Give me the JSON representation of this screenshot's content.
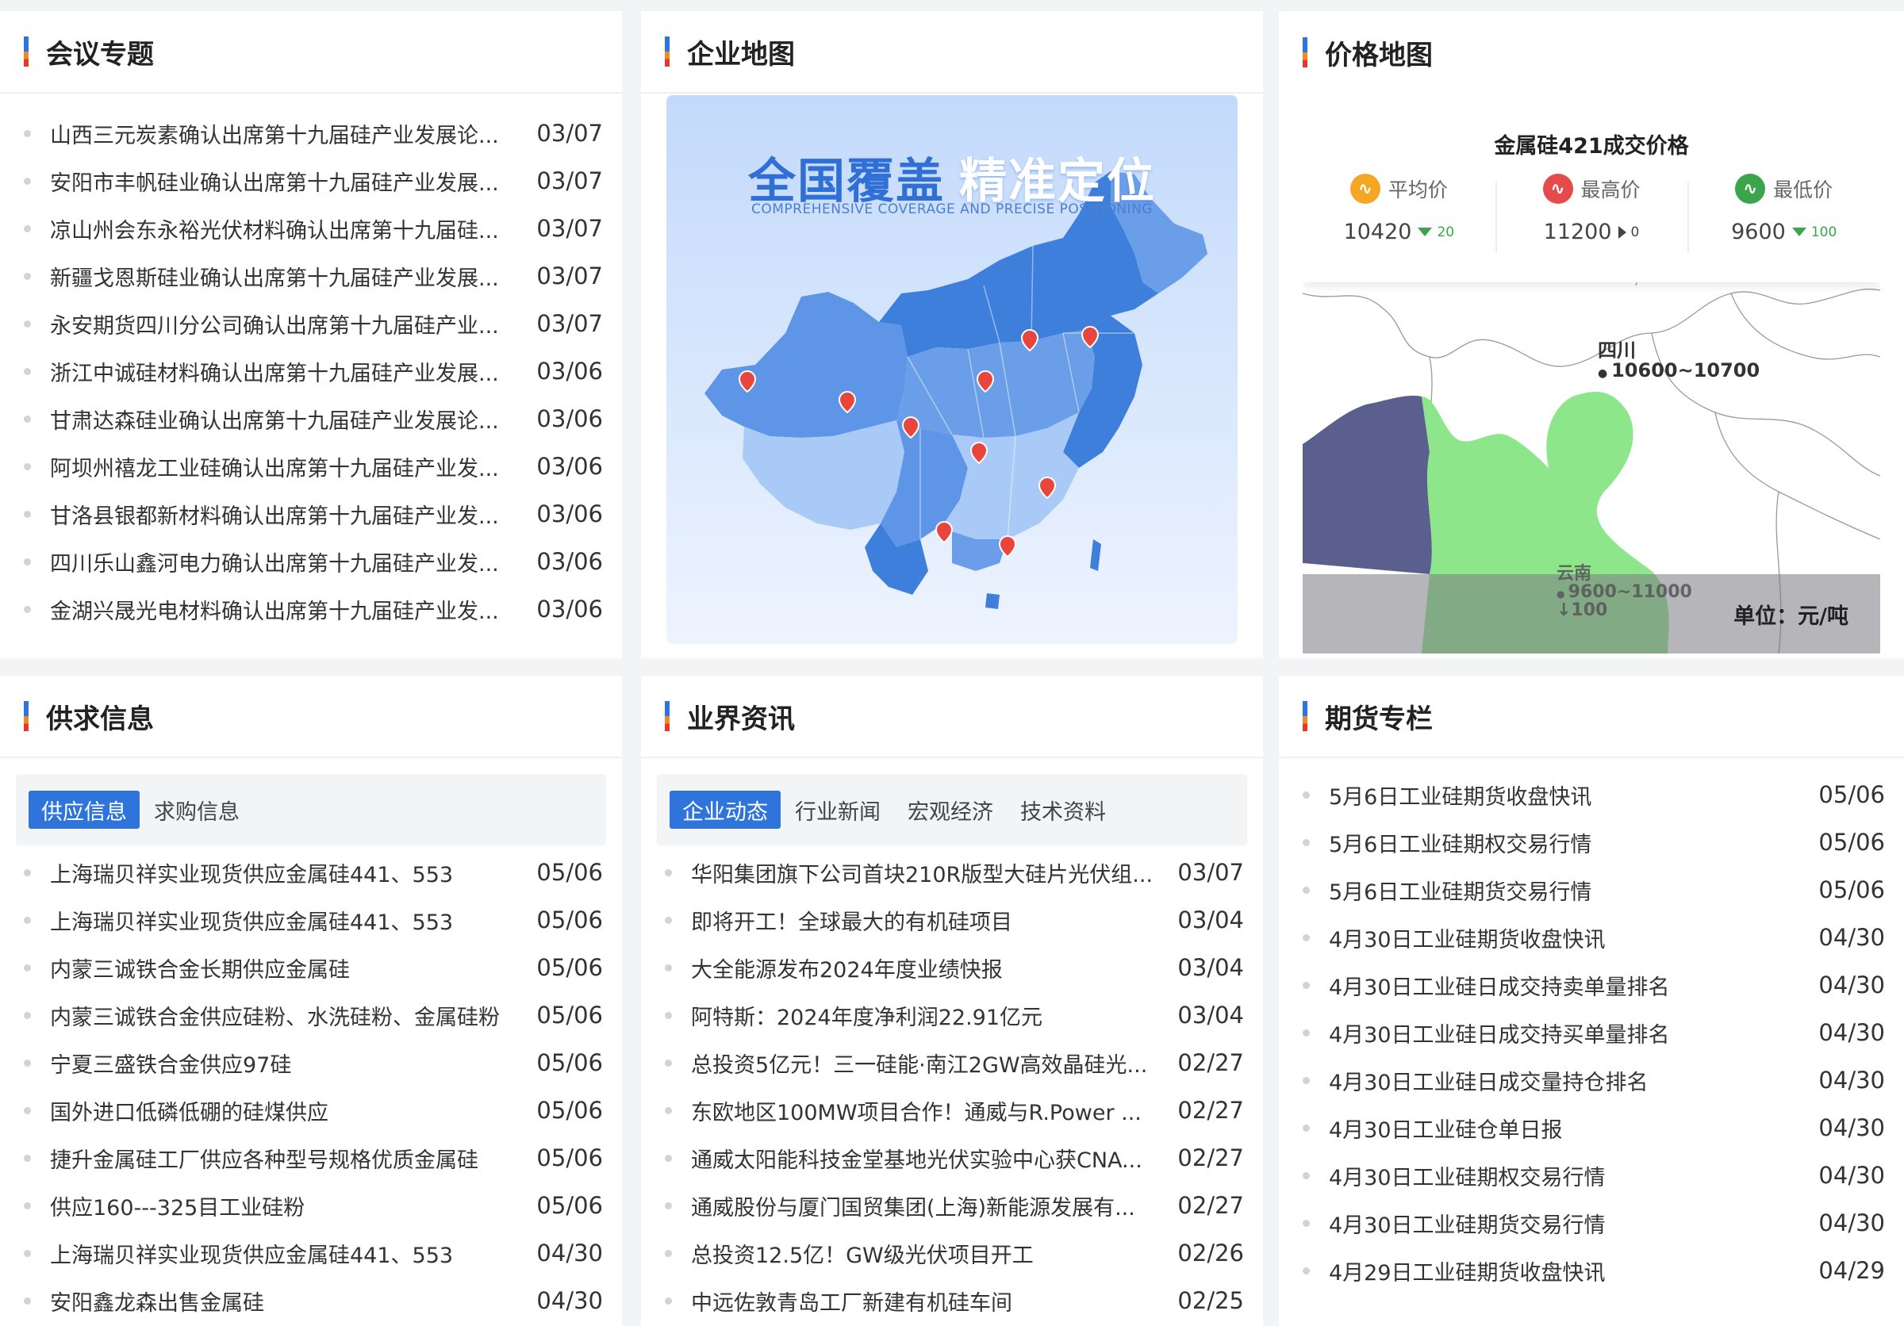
{
  "meeting": {
    "title": "会议专题",
    "items": [
      {
        "text": "山西三元炭素确认出席第十九届硅产业发展论...",
        "date": "03/07"
      },
      {
        "text": "安阳市丰帆硅业确认出席第十九届硅产业发展...",
        "date": "03/07"
      },
      {
        "text": "凉山州会东永裕光伏材料确认出席第十九届硅...",
        "date": "03/07"
      },
      {
        "text": "新疆戈恩斯硅业确认出席第十九届硅产业发展...",
        "date": "03/07"
      },
      {
        "text": "永安期货四川分公司确认出席第十九届硅产业...",
        "date": "03/07"
      },
      {
        "text": "浙江中诚硅材料确认出席第十九届硅产业发展...",
        "date": "03/06"
      },
      {
        "text": "甘肃达森硅业确认出席第十九届硅产业发展论...",
        "date": "03/06"
      },
      {
        "text": "阿坝州禧龙工业硅确认出席第十九届硅产业发...",
        "date": "03/06"
      },
      {
        "text": "甘洛县银都新材料确认出席第十九届硅产业发...",
        "date": "03/06"
      },
      {
        "text": "四川乐山鑫河电力确认出席第十九届硅产业发...",
        "date": "03/06"
      },
      {
        "text": "金湖兴晟光电材料确认出席第十九届硅产业发...",
        "date": "03/06"
      }
    ]
  },
  "enterprise_map": {
    "title": "企业地图",
    "headline_1": "全国覆盖",
    "headline_2": "精准定位",
    "subtitle": "COMPREHENSIVE COVERAGE AND PRECISE POSITIONING",
    "colors": {
      "dark": "#3f7fdc",
      "mid": "#6b9ee8",
      "light": "#a9c9f6",
      "pin": "#e8453c"
    }
  },
  "price_map": {
    "title": "价格地图",
    "panel_title": "金属硅421成交价格",
    "avg": {
      "label": "平均价",
      "value": "10420",
      "delta": "20",
      "icon": "wave-icon"
    },
    "max": {
      "label": "最高价",
      "value": "11200",
      "delta": "0",
      "icon": "up-icon"
    },
    "min": {
      "label": "最低价",
      "value": "9600",
      "delta": "100",
      "icon": "down-icon"
    },
    "sichuan": {
      "name": "四川",
      "range": "10600~10700"
    },
    "yunnan": {
      "name": "云南",
      "range": "9600~11000",
      "change": "↓100"
    },
    "unit": "单位：元/吨",
    "colors": {
      "yunnan": "#8ee68a",
      "west": "#5a5f8d"
    }
  },
  "supply": {
    "title": "供求信息",
    "tabs": [
      "供应信息",
      "求购信息"
    ],
    "items": [
      {
        "text": "上海瑞贝祥实业现货供应金属硅441、553",
        "date": "05/06"
      },
      {
        "text": "上海瑞贝祥实业现货供应金属硅441、553",
        "date": "05/06"
      },
      {
        "text": "内蒙三诚铁合金长期供应金属硅",
        "date": "05/06"
      },
      {
        "text": "内蒙三诚铁合金供应硅粉、水洗硅粉、金属硅粉",
        "date": "05/06"
      },
      {
        "text": "宁夏三盛铁合金供应97硅",
        "date": "05/06"
      },
      {
        "text": "国外进口低磷低硼的硅煤供应",
        "date": "05/06"
      },
      {
        "text": "捷升金属硅工厂供应各种型号规格优质金属硅",
        "date": "05/06"
      },
      {
        "text": "供应160---325目工业硅粉",
        "date": "05/06"
      },
      {
        "text": "上海瑞贝祥实业现货供应金属硅441、553",
        "date": "04/30"
      },
      {
        "text": "安阳鑫龙森出售金属硅",
        "date": "04/30"
      }
    ]
  },
  "industry": {
    "title": "业界资讯",
    "tabs": [
      "企业动态",
      "行业新闻",
      "宏观经济",
      "技术资料"
    ],
    "items": [
      {
        "text": "华阳集团旗下公司首块210R版型大硅片光伏组...",
        "date": "03/07"
      },
      {
        "text": "即将开工！全球最大的有机硅项目",
        "date": "03/04"
      },
      {
        "text": "大全能源发布2024年度业绩快报",
        "date": "03/04"
      },
      {
        "text": "阿特斯：2024年度净利润22.91亿元",
        "date": "03/04"
      },
      {
        "text": "总投资5亿元！三一硅能·南江2GW高效晶硅光...",
        "date": "02/27"
      },
      {
        "text": "东欧地区100MW项目合作！通威与R.Power ...",
        "date": "02/27"
      },
      {
        "text": "通威太阳能科技金堂基地光伏实验中心获CNA...",
        "date": "02/27"
      },
      {
        "text": "通威股份与厦门国贸集团(上海)新能源发展有...",
        "date": "02/27"
      },
      {
        "text": "总投资12.5亿！GW级光伏项目开工",
        "date": "02/26"
      },
      {
        "text": "中远佐敦青岛工厂新建有机硅车间",
        "date": "02/25"
      }
    ]
  },
  "futures": {
    "title": "期货专栏",
    "items": [
      {
        "text": "5月6日工业硅期货收盘快讯",
        "date": "05/06"
      },
      {
        "text": "5月6日工业硅期权交易行情",
        "date": "05/06"
      },
      {
        "text": "5月6日工业硅期货交易行情",
        "date": "05/06"
      },
      {
        "text": "4月30日工业硅期货收盘快讯",
        "date": "04/30"
      },
      {
        "text": "4月30日工业硅日成交持卖单量排名",
        "date": "04/30"
      },
      {
        "text": "4月30日工业硅日成交持买单量排名",
        "date": "04/30"
      },
      {
        "text": "4月30日工业硅日成交量持仓排名",
        "date": "04/30"
      },
      {
        "text": "4月30日工业硅仓单日报",
        "date": "04/30"
      },
      {
        "text": "4月30日工业硅期权交易行情",
        "date": "04/30"
      },
      {
        "text": "4月30日工业硅期货交易行情",
        "date": "04/30"
      },
      {
        "text": "4月29日工业硅期货收盘快讯",
        "date": "04/29"
      }
    ]
  }
}
